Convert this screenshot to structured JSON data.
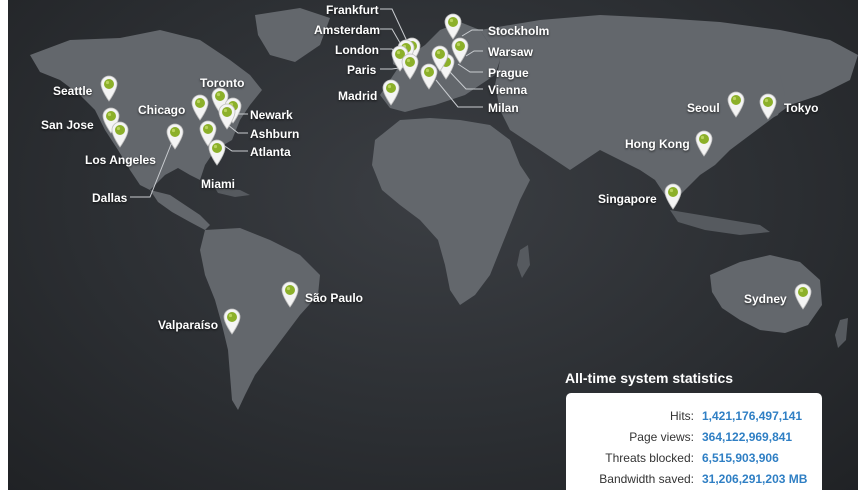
{
  "map": {
    "colors": {
      "ocean": "#2c2f33",
      "land": "#63676c",
      "pin": "#8cb02a",
      "stat_value": "#2f7fc4"
    },
    "cities": [
      {
        "name": "Frankfurt"
      },
      {
        "name": "Amsterdam"
      },
      {
        "name": "London"
      },
      {
        "name": "Paris"
      },
      {
        "name": "Madrid"
      },
      {
        "name": "Stockholm"
      },
      {
        "name": "Warsaw"
      },
      {
        "name": "Prague"
      },
      {
        "name": "Vienna"
      },
      {
        "name": "Milan"
      },
      {
        "name": "Seattle"
      },
      {
        "name": "San Jose"
      },
      {
        "name": "Los Angeles"
      },
      {
        "name": "Dallas"
      },
      {
        "name": "Chicago"
      },
      {
        "name": "Toronto"
      },
      {
        "name": "Newark"
      },
      {
        "name": "Ashburn"
      },
      {
        "name": "Atlanta"
      },
      {
        "name": "Miami"
      },
      {
        "name": "São Paulo"
      },
      {
        "name": "Valparaíso"
      },
      {
        "name": "Seoul"
      },
      {
        "name": "Tokyo"
      },
      {
        "name": "Hong Kong"
      },
      {
        "name": "Singapore"
      },
      {
        "name": "Sydney"
      }
    ]
  },
  "stats": {
    "title": "All-time system statistics",
    "rows": [
      {
        "label": "Hits:",
        "value": "1,421,176,497,141"
      },
      {
        "label": "Page views:",
        "value": "364,122,969,841"
      },
      {
        "label": "Threats blocked:",
        "value": "6,515,903,906"
      },
      {
        "label": "Bandwidth saved:",
        "value": "31,206,291,203 MB"
      }
    ]
  }
}
